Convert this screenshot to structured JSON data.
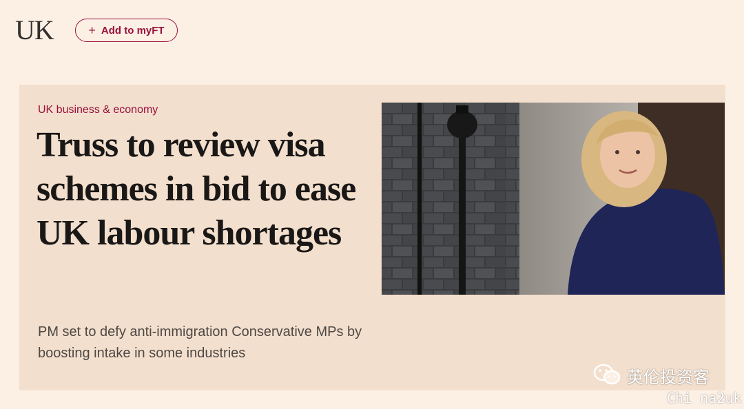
{
  "header": {
    "section_title": "UK",
    "add_to_myft_label": "Add to myFT",
    "add_icon": "plus-icon"
  },
  "article": {
    "topic": "UK business & economy",
    "headline": "Truss to review visa schemes in bid to ease UK labour shortages",
    "standfirst": "PM set to defy anti-immigration Conservative MPs by boosting intake in some industries",
    "image": "photo of woman in navy dress outside black brick door"
  },
  "watermark": {
    "icon": "wechat-icon",
    "text": "英伦投资客",
    "sub": "Chi na2uk"
  },
  "colors": {
    "page_bg": "#fcf0e5",
    "card_bg": "#f3dfcd",
    "accent": "#990f3d",
    "headline": "#1a1817"
  }
}
